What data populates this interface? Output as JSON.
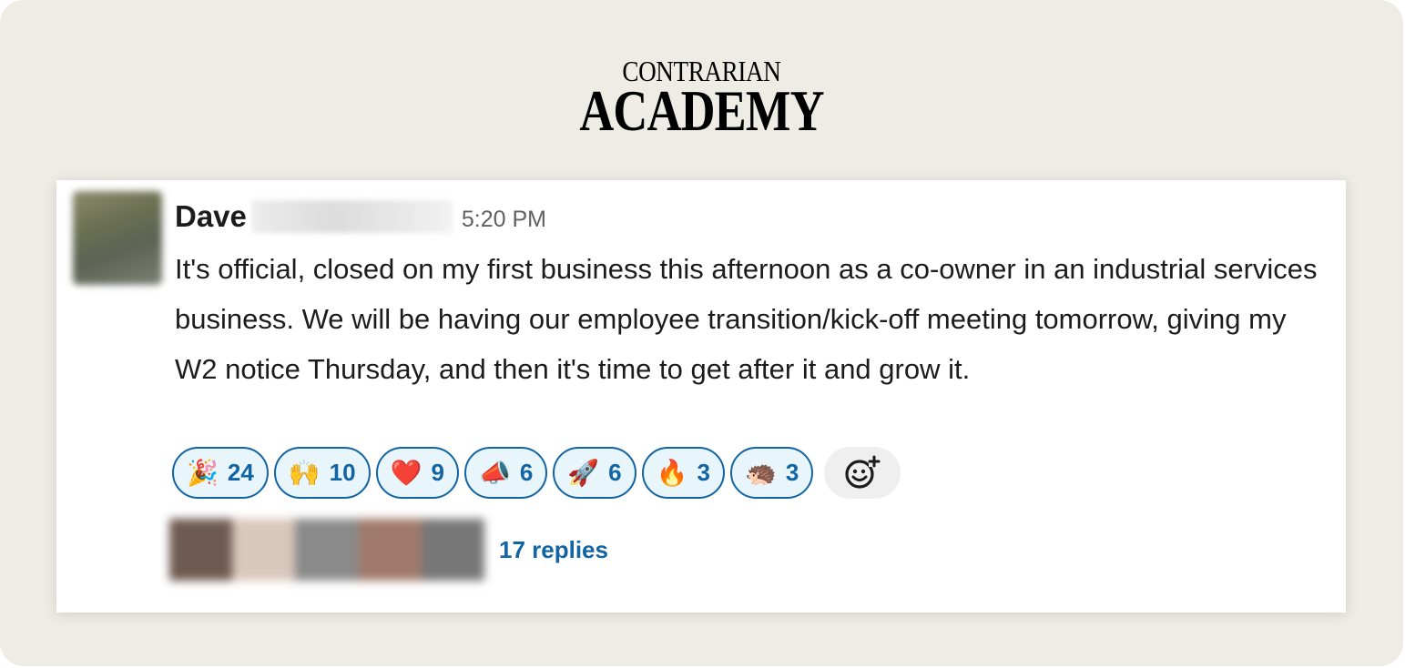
{
  "brand": {
    "line1": "CONTRARIAN",
    "line2": "ACADEMY"
  },
  "message": {
    "author": "Dave",
    "timestamp": "5:20 PM",
    "text": "It's official, closed on my first business this afternoon as a co-owner in an industrial services business. We will be having our employee transition/kick-off meeting tomorrow, giving my W2 notice Thursday, and then it's time to get after it and grow it.",
    "reactions": [
      {
        "emoji": "🎉",
        "count": "24"
      },
      {
        "emoji": "🙌",
        "count": "10"
      },
      {
        "emoji": "❤️",
        "count": "9"
      },
      {
        "emoji": "📣",
        "count": "6"
      },
      {
        "emoji": "🚀",
        "count": "6"
      },
      {
        "emoji": "🔥",
        "count": "3"
      },
      {
        "emoji": "🦔",
        "count": "3"
      }
    ],
    "add_reaction_icon": "add-emoji-icon",
    "replies": "17 replies"
  },
  "colors": {
    "accent": "#1264a3",
    "reaction_bg": "#e8f5fa",
    "frame_bg": "#efece5"
  }
}
